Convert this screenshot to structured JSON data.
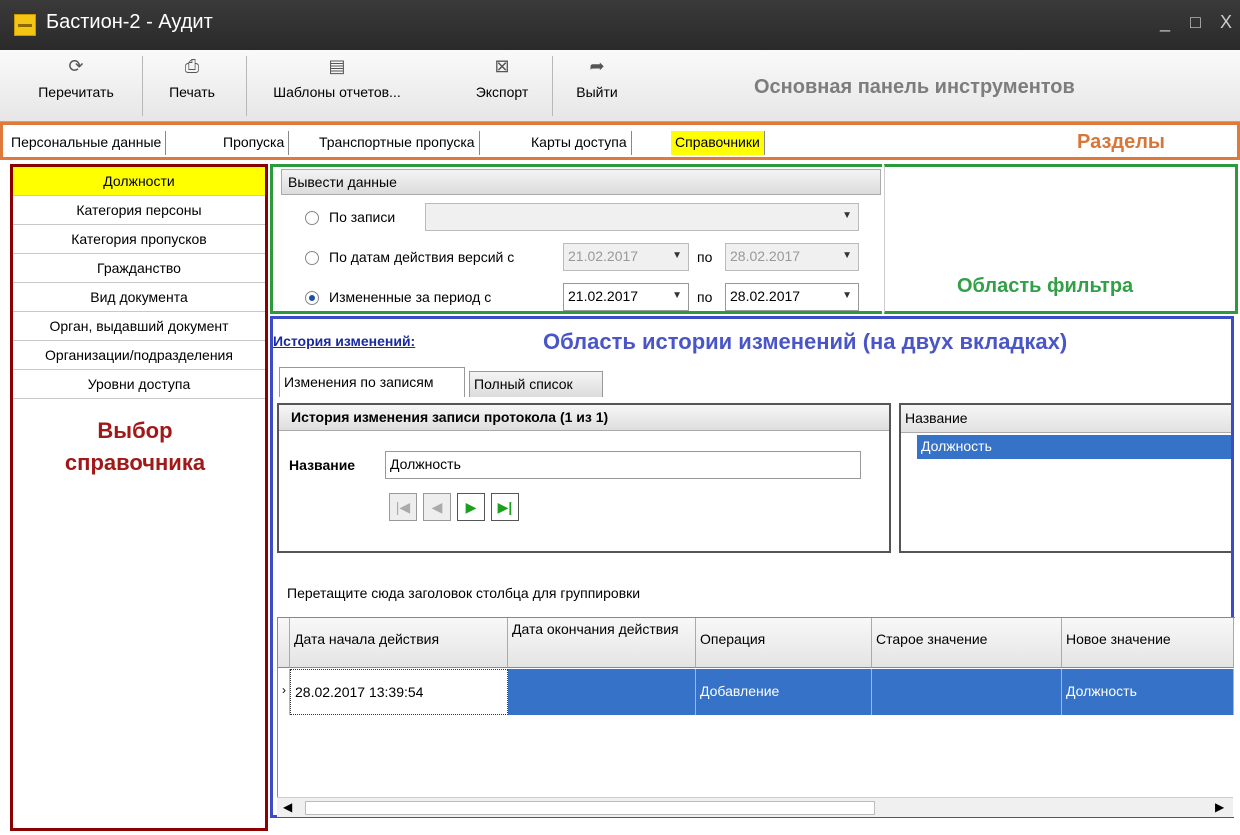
{
  "window": {
    "title": "Бастион-2 - Аудит",
    "minimize": "_",
    "maximize": "□",
    "close": "X"
  },
  "toolbar": {
    "buttons": [
      {
        "label": "Перечитать",
        "icon": "refresh-icon"
      },
      {
        "label": "Печать",
        "icon": "printer-icon"
      },
      {
        "label": "Шаблоны отчетов...",
        "icon": "report-template-icon"
      },
      {
        "label": "Экспорт",
        "icon": "export-icon"
      },
      {
        "label": "Выйти",
        "icon": "exit-icon"
      }
    ],
    "caption": "Основная панель инструментов"
  },
  "sections": {
    "tabs": [
      "Персональные данные",
      "Пропуска",
      "Транспортные пропуска",
      "Карты доступа",
      "Справочники"
    ],
    "active": "Справочники",
    "caption": "Разделы"
  },
  "directories": {
    "items": [
      "Должности",
      "Категория персоны",
      "Категория пропусков",
      "Гражданство",
      "Вид документа",
      "Орган, выдавший документ",
      "Организации/подразделения",
      "Уровни доступа"
    ],
    "active": "Должности",
    "caption_line1": "Выбор",
    "caption_line2": "справочника"
  },
  "filter": {
    "header": "Вывести данные",
    "by_record_label": "По записи",
    "by_record_value": "",
    "by_dates_label": "По датам действия версий с",
    "by_dates_from": "21.02.2017",
    "by_dates_to": "28.02.2017",
    "changed_label": "Измененные за период с",
    "changed_from": "21.02.2017",
    "changed_to": "28.02.2017",
    "to_word": "по",
    "selected": "changed",
    "caption": "Область фильтра"
  },
  "history": {
    "link": "История изменений:",
    "caption": "Область истории изменений (на двух вкладках)",
    "tabs": [
      "Изменения по записям",
      "Полный список"
    ],
    "record_header": "История изменения записи протокола (1 из 1)",
    "name_label": "Название",
    "name_value": "Должность",
    "names_column": "Название",
    "names_rows": [
      "Должность"
    ],
    "group_hint": "Перетащите сюда заголовок столбца для группировки",
    "columns": [
      "Дата начала действия",
      "Дата окончания действия",
      "Операция",
      "Старое значение",
      "Новое значение"
    ],
    "rows": [
      [
        "28.02.2017 13:39:54",
        "",
        "Добавление",
        "",
        "Должность"
      ]
    ]
  }
}
